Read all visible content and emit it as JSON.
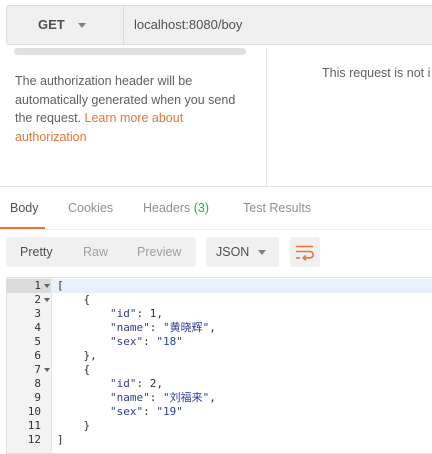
{
  "request": {
    "method": "GET",
    "url": "localhost:8080/boy"
  },
  "auth": {
    "message": "The authorization header will be automatically generated when you send the request.",
    "link_text": "Learn more about authorization",
    "right_message": "This request is not i"
  },
  "response_tabs": [
    {
      "label": "Body",
      "active": true
    },
    {
      "label": "Cookies"
    },
    {
      "label": "Headers",
      "count": "(3)"
    },
    {
      "label": "Test Results"
    }
  ],
  "view_modes": [
    "Pretty",
    "Raw",
    "Preview"
  ],
  "selected_view": "Pretty",
  "format": {
    "selected": "JSON"
  },
  "icons": {
    "method_dropdown": "chevron-down-icon",
    "format_dropdown": "chevron-down-icon",
    "wrap": "wrap-lines-icon",
    "fold": "fold-arrow-icon"
  },
  "colors": {
    "accent": "#e8743b",
    "count": "#26a65b",
    "json_key": "#2d3ca6"
  },
  "code_lines": [
    {
      "n": "1",
      "text": "[",
      "fold": true,
      "active": true
    },
    {
      "n": "2",
      "text": "    {",
      "fold": true
    },
    {
      "n": "3",
      "text": "        \"id\": 1,"
    },
    {
      "n": "4",
      "text": "        \"name\": \"黄晓辉\","
    },
    {
      "n": "5",
      "text": "        \"sex\": \"18\""
    },
    {
      "n": "6",
      "text": "    },"
    },
    {
      "n": "7",
      "text": "    {",
      "fold": true
    },
    {
      "n": "8",
      "text": "        \"id\": 2,"
    },
    {
      "n": "9",
      "text": "        \"name\": \"刘福来\","
    },
    {
      "n": "10",
      "text": "        \"sex\": \"19\""
    },
    {
      "n": "11",
      "text": "    }"
    },
    {
      "n": "12",
      "text": "]"
    }
  ]
}
